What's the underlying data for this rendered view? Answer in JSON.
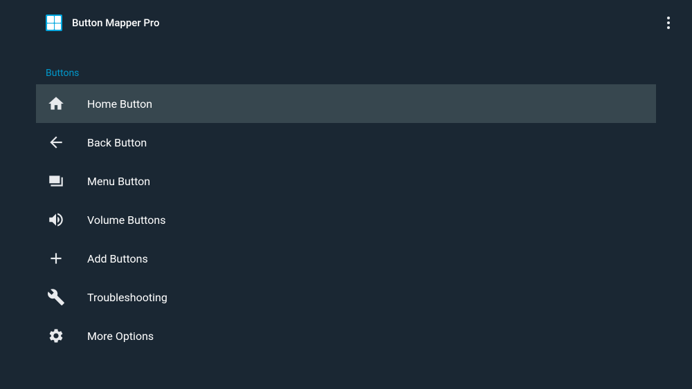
{
  "header": {
    "title": "Button Mapper Pro"
  },
  "section": {
    "header": "Buttons"
  },
  "menu": {
    "items": [
      {
        "label": "Home Button",
        "icon": "home-icon",
        "selected": true
      },
      {
        "label": "Back Button",
        "icon": "back-icon",
        "selected": false
      },
      {
        "label": "Menu Button",
        "icon": "menu-icon",
        "selected": false
      },
      {
        "label": "Volume Buttons",
        "icon": "volume-icon",
        "selected": false
      },
      {
        "label": "Add Buttons",
        "icon": "plus-icon",
        "selected": false
      },
      {
        "label": "Troubleshooting",
        "icon": "tools-icon",
        "selected": false
      },
      {
        "label": "More Options",
        "icon": "settings-icon",
        "selected": false
      }
    ]
  }
}
